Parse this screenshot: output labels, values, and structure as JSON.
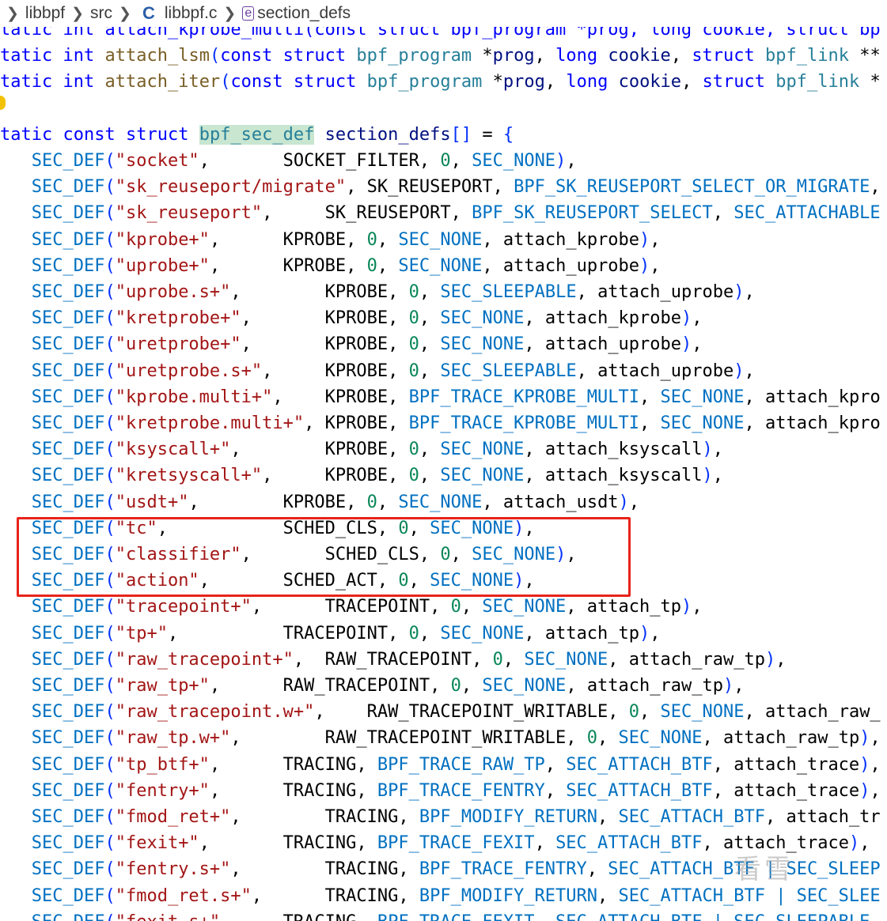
{
  "breadcrumb": {
    "items": [
      "libbpf",
      "src",
      "libbpf.c",
      "section_defs"
    ]
  },
  "code": {
    "partial_top": "tatic int attach_kprobe_multi(const struct bpf_program *prog, long cookie, struct bp",
    "lsm": {
      "kw": "tatic",
      "ty": "int",
      "fn": "attach_lsm",
      "rest_kw1": "const",
      "rest_kw2": "struct",
      "ty2": "bpf_program",
      "p1": "*",
      "id1": "prog",
      "kw3": "long",
      "id2": "cookie",
      "kw4": "struct",
      "ty3": "bpf_link",
      "tail": " **"
    },
    "iter": {
      "kw": "tatic",
      "ty": "int",
      "fn": "attach_iter",
      "rest_kw1": "const",
      "rest_kw2": "struct",
      "ty2": "bpf_program",
      "p1": "*",
      "id1": "prog",
      "kw3": "long",
      "id2": "cookie",
      "kw4": "struct",
      "ty3": "bpf_link",
      "tail": " *"
    },
    "decl": {
      "kw1": "tatic",
      "kw2": "const",
      "kw3": "struct",
      "ty": "bpf_sec_def",
      "id": "section_defs",
      "tail": "[] = {"
    },
    "entries": [
      {
        "name": "\"socket\"",
        "pad": ",       ",
        "args": [
          [
            "SOCKET_FILTER",
            "p"
          ],
          [
            "0",
            "n"
          ],
          [
            "SEC_NONE",
            "m"
          ]
        ],
        "end": "),"
      },
      {
        "name": "\"sk_reuseport/migrate\"",
        "pad": ", ",
        "args": [
          [
            "SK_REUSEPORT",
            "p"
          ],
          [
            "BPF_SK_REUSEPORT_SELECT_OR_MIGRATE",
            "m"
          ]
        ],
        "end": ","
      },
      {
        "name": "\"sk_reuseport\"",
        "pad": ",     ",
        "args": [
          [
            "SK_REUSEPORT",
            "p"
          ],
          [
            "BPF_SK_REUSEPORT_SELECT",
            "m"
          ],
          [
            "SEC_ATTACHABLE",
            "m"
          ]
        ],
        "end": ""
      },
      {
        "name": "\"kprobe+\"",
        "pad": ",      ",
        "args": [
          [
            "KPROBE",
            "p"
          ],
          [
            "0",
            "n"
          ],
          [
            "SEC_NONE",
            "m"
          ],
          [
            "attach_kprobe",
            "p"
          ]
        ],
        "end": "),"
      },
      {
        "name": "\"uprobe+\"",
        "pad": ",      ",
        "args": [
          [
            "KPROBE",
            "p"
          ],
          [
            "0",
            "n"
          ],
          [
            "SEC_NONE",
            "m"
          ],
          [
            "attach_uprobe",
            "p"
          ]
        ],
        "end": "),"
      },
      {
        "name": "\"uprobe.s+\"",
        "pad": ",        ",
        "args": [
          [
            "KPROBE",
            "p"
          ],
          [
            "0",
            "n"
          ],
          [
            "SEC_SLEEPABLE",
            "m"
          ],
          [
            "attach_uprobe",
            "p"
          ]
        ],
        "end": "),"
      },
      {
        "name": "\"kretprobe+\"",
        "pad": ",       ",
        "args": [
          [
            "KPROBE",
            "p"
          ],
          [
            "0",
            "n"
          ],
          [
            "SEC_NONE",
            "m"
          ],
          [
            "attach_kprobe",
            "p"
          ]
        ],
        "end": "),"
      },
      {
        "name": "\"uretprobe+\"",
        "pad": ",       ",
        "args": [
          [
            "KPROBE",
            "p"
          ],
          [
            "0",
            "n"
          ],
          [
            "SEC_NONE",
            "m"
          ],
          [
            "attach_uprobe",
            "p"
          ]
        ],
        "end": "),"
      },
      {
        "name": "\"uretprobe.s+\"",
        "pad": ",     ",
        "args": [
          [
            "KPROBE",
            "p"
          ],
          [
            "0",
            "n"
          ],
          [
            "SEC_SLEEPABLE",
            "m"
          ],
          [
            "attach_uprobe",
            "p"
          ]
        ],
        "end": "),"
      },
      {
        "name": "\"kprobe.multi+\"",
        "pad": ",    ",
        "args": [
          [
            "KPROBE",
            "p"
          ],
          [
            "BPF_TRACE_KPROBE_MULTI",
            "m"
          ],
          [
            "SEC_NONE",
            "m"
          ],
          [
            "attach_kpro",
            "p"
          ]
        ],
        "end": ""
      },
      {
        "name": "\"kretprobe.multi+\"",
        "pad": ", ",
        "args": [
          [
            "KPROBE",
            "p"
          ],
          [
            "BPF_TRACE_KPROBE_MULTI",
            "m"
          ],
          [
            "SEC_NONE",
            "m"
          ],
          [
            "attach_kpro",
            "p"
          ]
        ],
        "end": ""
      },
      {
        "name": "\"ksyscall+\"",
        "pad": ",        ",
        "args": [
          [
            "KPROBE",
            "p"
          ],
          [
            "0",
            "n"
          ],
          [
            "SEC_NONE",
            "m"
          ],
          [
            "attach_ksyscall",
            "p"
          ]
        ],
        "end": "),"
      },
      {
        "name": "\"kretsyscall+\"",
        "pad": ",     ",
        "args": [
          [
            "KPROBE",
            "p"
          ],
          [
            "0",
            "n"
          ],
          [
            "SEC_NONE",
            "m"
          ],
          [
            "attach_ksyscall",
            "p"
          ]
        ],
        "end": "),"
      },
      {
        "name": "\"usdt+\"",
        "pad": ",        ",
        "args": [
          [
            "KPROBE",
            "p"
          ],
          [
            "0",
            "n"
          ],
          [
            "SEC_NONE",
            "m"
          ],
          [
            "attach_usdt",
            "p"
          ]
        ],
        "end": "),"
      },
      {
        "name": "\"tc\"",
        "pad": ",           ",
        "args": [
          [
            "SCHED_CLS",
            "p"
          ],
          [
            "0",
            "n"
          ],
          [
            "SEC_NONE",
            "m"
          ]
        ],
        "end": "),"
      },
      {
        "name": "\"classifier\"",
        "pad": ",       ",
        "args": [
          [
            "SCHED_CLS",
            "p"
          ],
          [
            "0",
            "n"
          ],
          [
            "SEC_NONE",
            "m"
          ]
        ],
        "end": "),"
      },
      {
        "name": "\"action\"",
        "pad": ",       ",
        "args": [
          [
            "SCHED_ACT",
            "p"
          ],
          [
            "0",
            "n"
          ],
          [
            "SEC_NONE",
            "m"
          ]
        ],
        "end": "),"
      },
      {
        "name": "\"tracepoint+\"",
        "pad": ",      ",
        "args": [
          [
            "TRACEPOINT",
            "p"
          ],
          [
            "0",
            "n"
          ],
          [
            "SEC_NONE",
            "m"
          ],
          [
            "attach_tp",
            "p"
          ]
        ],
        "end": "),"
      },
      {
        "name": "\"tp+\"",
        "pad": ",          ",
        "args": [
          [
            "TRACEPOINT",
            "p"
          ],
          [
            "0",
            "n"
          ],
          [
            "SEC_NONE",
            "m"
          ],
          [
            "attach_tp",
            "p"
          ]
        ],
        "end": "),"
      },
      {
        "name": "\"raw_tracepoint+\"",
        "pad": ",  ",
        "args": [
          [
            "RAW_TRACEPOINT",
            "p"
          ],
          [
            "0",
            "n"
          ],
          [
            "SEC_NONE",
            "m"
          ],
          [
            "attach_raw_tp",
            "p"
          ]
        ],
        "end": "),"
      },
      {
        "name": "\"raw_tp+\"",
        "pad": ",      ",
        "args": [
          [
            "RAW_TRACEPOINT",
            "p"
          ],
          [
            "0",
            "n"
          ],
          [
            "SEC_NONE",
            "m"
          ],
          [
            "attach_raw_tp",
            "p"
          ]
        ],
        "end": "),"
      },
      {
        "name": "\"raw_tracepoint.w+\"",
        "pad": ",    ",
        "args": [
          [
            "RAW_TRACEPOINT_WRITABLE",
            "p"
          ],
          [
            "0",
            "n"
          ],
          [
            "SEC_NONE",
            "m"
          ],
          [
            "attach_raw_",
            "p"
          ]
        ],
        "end": ""
      },
      {
        "name": "\"raw_tp.w+\"",
        "pad": ",        ",
        "args": [
          [
            "RAW_TRACEPOINT_WRITABLE",
            "p"
          ],
          [
            "0",
            "n"
          ],
          [
            "SEC_NONE",
            "m"
          ],
          [
            "attach_raw_tp",
            "p"
          ]
        ],
        "end": "),"
      },
      {
        "name": "\"tp_btf+\"",
        "pad": ",      ",
        "args": [
          [
            "TRACING",
            "p"
          ],
          [
            "BPF_TRACE_RAW_TP",
            "m"
          ],
          [
            "SEC_ATTACH_BTF",
            "m"
          ],
          [
            "attach_trace",
            "p"
          ]
        ],
        "end": "),"
      },
      {
        "name": "\"fentry+\"",
        "pad": ",      ",
        "args": [
          [
            "TRACING",
            "p"
          ],
          [
            "BPF_TRACE_FENTRY",
            "m"
          ],
          [
            "SEC_ATTACH_BTF",
            "m"
          ],
          [
            "attach_trace",
            "p"
          ]
        ],
        "end": "),"
      },
      {
        "name": "\"fmod_ret+\"",
        "pad": ",        ",
        "args": [
          [
            "TRACING",
            "p"
          ],
          [
            "BPF_MODIFY_RETURN",
            "m"
          ],
          [
            "SEC_ATTACH_BTF",
            "m"
          ],
          [
            "attach_tr",
            "p"
          ]
        ],
        "end": ""
      },
      {
        "name": "\"fexit+\"",
        "pad": ",       ",
        "args": [
          [
            "TRACING",
            "p"
          ],
          [
            "BPF_TRACE_FEXIT",
            "m"
          ],
          [
            "SEC_ATTACH_BTF",
            "m"
          ],
          [
            "attach_trace",
            "p"
          ]
        ],
        "end": "),"
      },
      {
        "name": "\"fentry.s+\"",
        "pad": ",        ",
        "args": [
          [
            "TRACING",
            "p"
          ],
          [
            "BPF_TRACE_FENTRY",
            "m"
          ],
          [
            "SEC_ATTACH_BTF | SEC_SLEEP",
            "m"
          ]
        ],
        "end": ""
      },
      {
        "name": "\"fmod_ret.s+\"",
        "pad": ",      ",
        "args": [
          [
            "TRACING",
            "p"
          ],
          [
            "BPF_MODIFY_RETURN",
            "m"
          ],
          [
            "SEC_ATTACH_BTF | SEC_SLEE",
            "m"
          ]
        ],
        "end": ""
      },
      {
        "name": "\"fexit.s+\"",
        "pad": ",     ",
        "args": [
          [
            "TRACING",
            "p"
          ],
          [
            "BPF_TRACE_FEXIT",
            "m"
          ],
          [
            "SEC_ATTACH_BTF | SEC_SLEEPABLE",
            "m"
          ]
        ],
        "end": ""
      }
    ]
  },
  "colors": {
    "highlight_box": "#e8231a",
    "keyword": "#0000ff",
    "type": "#267f99",
    "function": "#795e26",
    "string": "#a31515",
    "macro": "#0070c1",
    "number": "#098658"
  },
  "watermark": "看雪"
}
